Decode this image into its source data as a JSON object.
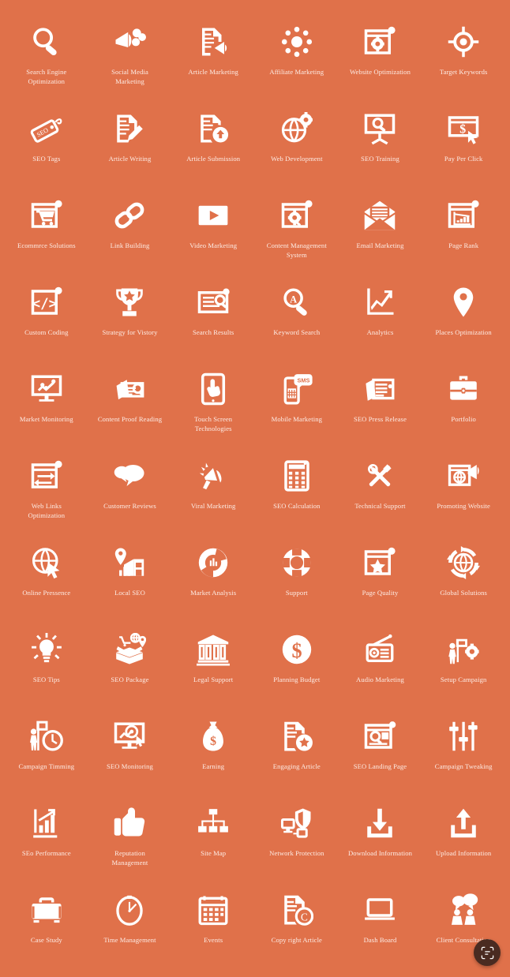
{
  "page": {
    "background_color": "#e0714a",
    "icon_color": "#ffffff",
    "label_color": "#fdece5",
    "columns": 6,
    "rows": 12,
    "total_icons": 72
  },
  "fab": {
    "icon": "scan-lens-icon",
    "background_color": "#4a2b21",
    "label": ""
  },
  "icons": [
    {
      "label": "Search Engine\nOptimization",
      "icon": "magnifier-icon"
    },
    {
      "label": "Social Media\nMarketing",
      "icon": "megaphone-social-icon"
    },
    {
      "label": "Article Marketing",
      "icon": "document-megaphone-icon"
    },
    {
      "label": "Affiliate Marketing",
      "icon": "user-network-dots-icon"
    },
    {
      "label": "Website Optimization",
      "icon": "browser-gear-icon"
    },
    {
      "label": "Target Keywords",
      "icon": "crosshair-target-icon"
    },
    {
      "label": "SEO Tags",
      "icon": "seo-tag-icon"
    },
    {
      "label": "Article Writing",
      "icon": "document-pencil-icon"
    },
    {
      "label": "Article Submission",
      "icon": "document-upload-icon"
    },
    {
      "label": "Web Development",
      "icon": "globe-gear-icon"
    },
    {
      "label": "SEO Training",
      "icon": "presentation-board-icon"
    },
    {
      "label": "Pay Per Click",
      "icon": "dollar-cursor-icon"
    },
    {
      "label": "Ecommrce Solutions",
      "icon": "browser-cart-icon"
    },
    {
      "label": "Link Building",
      "icon": "chain-link-icon"
    },
    {
      "label": "Video Marketing",
      "icon": "video-play-icon"
    },
    {
      "label": "Content Management\nSystem",
      "icon": "browser-cms-gear-icon"
    },
    {
      "label": "Email Marketing",
      "icon": "open-envelope-icon"
    },
    {
      "label": "Page Rank",
      "icon": "browser-chart-down-icon"
    },
    {
      "label": "Custom Coding",
      "icon": "browser-code-icon"
    },
    {
      "label": "Strategy for Vistory",
      "icon": "trophy-icon"
    },
    {
      "label": "Search Results",
      "icon": "browser-search-results-icon"
    },
    {
      "label": "Keyword Search",
      "icon": "magnifier-a-icon"
    },
    {
      "label": "Analytics",
      "icon": "line-chart-arrow-icon"
    },
    {
      "label": "Places Optimization",
      "icon": "map-pin-icon"
    },
    {
      "label": "Market Monitoring",
      "icon": "monitor-chart-icon"
    },
    {
      "label": "Content Proof Reading",
      "icon": "cards-magnifier-icon"
    },
    {
      "label": "Touch Screen\nTechnologies",
      "icon": "tablet-hand-icon"
    },
    {
      "label": "Mobile Marketing",
      "icon": "phone-sms-icon"
    },
    {
      "label": "SEO Press Release",
      "icon": "newspaper-icon"
    },
    {
      "label": "Portfolio",
      "icon": "briefcase-icon"
    },
    {
      "label": "Web Links\nOptimization",
      "icon": "browser-exchange-arrows-icon"
    },
    {
      "label": "Customer Reviews",
      "icon": "speech-bubbles-icon"
    },
    {
      "label": "Viral Marketing",
      "icon": "viral-megaphone-icon"
    },
    {
      "label": "SEO Calculation",
      "icon": "calculator-icon"
    },
    {
      "label": "Technical Support",
      "icon": "wrench-screwdriver-icon"
    },
    {
      "label": "Promoting Website",
      "icon": "browser-globe-megaphone-icon"
    },
    {
      "label": "Online Pressence",
      "icon": "globe-cursor-icon"
    },
    {
      "label": "Local SEO",
      "icon": "pin-storefront-icon"
    },
    {
      "label": "Market Analysis",
      "icon": "donut-chart-icon"
    },
    {
      "label": "Support",
      "icon": "lifebuoy-icon"
    },
    {
      "label": "Page Quality",
      "icon": "browser-star-icon"
    },
    {
      "label": "Global Solutions",
      "icon": "globe-arrows-icon"
    },
    {
      "label": "SEO Tips",
      "icon": "lightbulb-icon"
    },
    {
      "label": "SEO Package",
      "icon": "open-box-icon"
    },
    {
      "label": "Legal Support",
      "icon": "bank-columns-icon"
    },
    {
      "label": "Planning Budget",
      "icon": "dollar-coin-icon"
    },
    {
      "label": "Audio Marketing",
      "icon": "radio-icon"
    },
    {
      "label": "Setup Campaign",
      "icon": "person-flag-gear-icon"
    },
    {
      "label": "Campaign Timming",
      "icon": "person-flag-clock-icon"
    },
    {
      "label": "SEO Monitoring",
      "icon": "monitor-target-chart-icon"
    },
    {
      "label": "Earning",
      "icon": "money-bag-icon"
    },
    {
      "label": "Engaging Article",
      "icon": "document-star-badge-icon"
    },
    {
      "label": "SEO Landing Page",
      "icon": "browser-landing-search-icon"
    },
    {
      "label": "Campaign Tweaking",
      "icon": "sliders-icon"
    },
    {
      "label": "SEo Performance",
      "icon": "bar-chart-arrow-icon"
    },
    {
      "label": "Reputation\nManagement",
      "icon": "thumbs-up-icon"
    },
    {
      "label": "Site Map",
      "icon": "sitemap-icon"
    },
    {
      "label": "Network Protection",
      "icon": "shield-network-icon"
    },
    {
      "label": "Download Information",
      "icon": "download-tray-icon"
    },
    {
      "label": "Upload Information",
      "icon": "upload-tray-icon"
    },
    {
      "label": "Case Study",
      "icon": "suitcase-icon"
    },
    {
      "label": "Time Management",
      "icon": "stopwatch-icon"
    },
    {
      "label": "Events",
      "icon": "calendar-icon"
    },
    {
      "label": "Copy right Article",
      "icon": "document-copyright-icon"
    },
    {
      "label": "Dash Board",
      "icon": "laptop-icon"
    },
    {
      "label": "Client Consultation",
      "icon": "consultation-bubbles-icon"
    }
  ]
}
